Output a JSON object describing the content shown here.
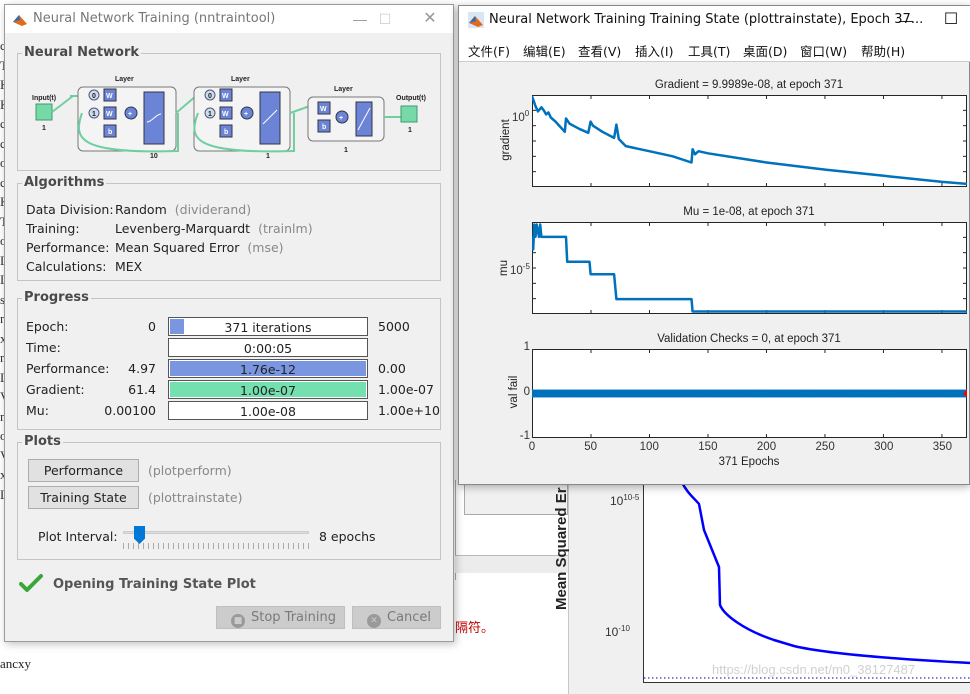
{
  "background": {
    "editor_left_chars": [
      "c",
      "T",
      "K",
      "K",
      "c",
      "c",
      "o",
      "c",
      "K",
      "T",
      "o",
      "L",
      "L",
      "s",
      "n",
      "x",
      "n",
      "L",
      "V",
      "n",
      "o",
      "V",
      "x",
      "L"
    ],
    "editor_bottom_text": "ancxy",
    "red_text": "隔符。",
    "perf_plot": {
      "ylabel": "Mean Squared Er",
      "yticks": [
        "10-5",
        "10-10"
      ],
      "watermark": "https://blog.csdn.net/m0_38127487"
    }
  },
  "nntraintool": {
    "title": "Neural Network Training (nntraintool)",
    "window_buttons": {
      "minimize": "—",
      "maximize": "☐",
      "close": "✕"
    },
    "network": {
      "group_title": "Neural Network",
      "input_label": "Input(t)",
      "input_size": "1",
      "output_label": "Output(t)",
      "output_size": "1",
      "layers": [
        {
          "label": "Layer",
          "size": "10",
          "delays": [
            "0",
            "1"
          ],
          "transfer": "tansig"
        },
        {
          "label": "Layer",
          "size": "1",
          "delays": [
            "0",
            "1"
          ],
          "transfer": "purelin"
        },
        {
          "label": "Layer",
          "size": "1",
          "delays": [],
          "transfer": "purelin"
        }
      ],
      "weight_label": "W",
      "bias_label": "b",
      "sum_label": "+"
    },
    "algorithms": {
      "group_title": "Algorithms",
      "rows": [
        {
          "key": "Data Division:",
          "value": "Random",
          "fn": "(dividerand)"
        },
        {
          "key": "Training:",
          "value": "Levenberg-Marquardt",
          "fn": "(trainlm)"
        },
        {
          "key": "Performance:",
          "value": "Mean Squared Error",
          "fn": "(mse)"
        },
        {
          "key": "Calculations:",
          "value": "MEX",
          "fn": ""
        }
      ]
    },
    "progress": {
      "group_title": "Progress",
      "rows": [
        {
          "label": "Epoch:",
          "min": "0",
          "value": "371 iterations",
          "max": "5000",
          "fill_fraction": 0.074,
          "fill_color": "#7b96e0"
        },
        {
          "label": "Time:",
          "min": "",
          "value": "0:00:05",
          "max": "",
          "fill_fraction": 0,
          "fill_color": "#7b96e0"
        },
        {
          "label": "Performance:",
          "min": "4.97",
          "value": "1.76e-12",
          "max": "0.00",
          "fill_fraction": 1.0,
          "fill_color": "#7b96e0"
        },
        {
          "label": "Gradient:",
          "min": "61.4",
          "value": "1.00e-07",
          "max": "1.00e-07",
          "fill_fraction": 1.0,
          "fill_color": "#74e0b0"
        },
        {
          "label": "Mu:",
          "min": "0.00100",
          "value": "1.00e-08",
          "max": "1.00e+10",
          "fill_fraction": 0,
          "fill_color": "#7b96e0"
        }
      ]
    },
    "plots": {
      "group_title": "Plots",
      "buttons": [
        {
          "label": "Performance",
          "fn": "(plotperform)"
        },
        {
          "label": "Training State",
          "fn": "(plottrainstate)"
        }
      ],
      "interval_label": "Plot Interval:",
      "interval_value": "8 epochs",
      "interval_fraction": 0.07
    },
    "status": "Opening Training State Plot",
    "stop_button": "Stop Training",
    "cancel_button": "Cancel"
  },
  "trainstate": {
    "title": "Neural Network Training Training State (plottrainstate), Epoch 37...",
    "window_buttons": {
      "minimize": "—",
      "maximize": "☐"
    },
    "menu": [
      "文件(F)",
      "编辑(E)",
      "查看(V)",
      "插入(I)",
      "工具(T)",
      "桌面(D)",
      "窗口(W)",
      "帮助(H)"
    ]
  },
  "chart_data": [
    {
      "type": "line",
      "title": "Gradient = 9.9989e-08, at epoch 371",
      "xlabel": "",
      "ylabel": "gradient",
      "yscale": "log",
      "ytick_labels": [
        "10^0"
      ],
      "xlim": [
        0,
        371
      ],
      "ylim_log10": [
        -7.3,
        1.7
      ],
      "x": [
        0,
        3,
        5,
        8,
        10,
        12,
        14,
        16,
        20,
        28,
        29,
        32,
        40,
        48,
        50,
        52,
        60,
        70,
        72,
        74,
        80,
        100,
        120,
        136,
        137,
        139,
        142,
        150,
        200,
        250,
        300,
        350,
        371
      ],
      "y_log10": [
        1.7,
        0.6,
        0.1,
        0.5,
        0.2,
        -0.2,
        0.0,
        -0.5,
        -0.9,
        -1.9,
        -0.6,
        -1.1,
        -1.6,
        -2.0,
        -0.9,
        -1.3,
        -1.9,
        -2.5,
        -1.2,
        -2.6,
        -3.3,
        -3.8,
        -4.3,
        -4.9,
        -3.6,
        -4.1,
        -3.8,
        -4.0,
        -4.9,
        -5.6,
        -6.2,
        -6.8,
        -7.0
      ],
      "color": "#0072bd"
    },
    {
      "type": "line",
      "title": "Mu = 1e-08, at epoch 371",
      "xlabel": "",
      "ylabel": "mu",
      "yscale": "log",
      "ytick_labels": [
        "10^-5"
      ],
      "xlim": [
        0,
        371
      ],
      "ylim_log10": [
        -8.2,
        -0.8
      ],
      "x": [
        0,
        1,
        2,
        3,
        4,
        6,
        7,
        8,
        29,
        30,
        49,
        50,
        70,
        72,
        136,
        137,
        371
      ],
      "y_log10": [
        -2,
        -3,
        -1,
        -2,
        -1,
        -2,
        -1,
        -2,
        -2,
        -4,
        -4,
        -5,
        -5,
        -7,
        -7,
        -8,
        -8
      ],
      "color": "#0072bd"
    },
    {
      "type": "scatter",
      "title": "Validation Checks = 0, at epoch 371",
      "xlabel": "371 Epochs",
      "ylabel": "val fail",
      "xlim": [
        0,
        371
      ],
      "ylim": [
        -1,
        1
      ],
      "xticks": [
        0,
        50,
        100,
        150,
        200,
        250,
        300,
        350
      ],
      "yticks": [
        -1,
        0,
        1
      ],
      "series": [
        {
          "name": "val fail",
          "value_all_epochs": 0,
          "epochs": 371,
          "color": "#0072bd"
        }
      ],
      "final_marker": {
        "x": 371,
        "y": 0,
        "color": "#ff0000"
      }
    }
  ]
}
